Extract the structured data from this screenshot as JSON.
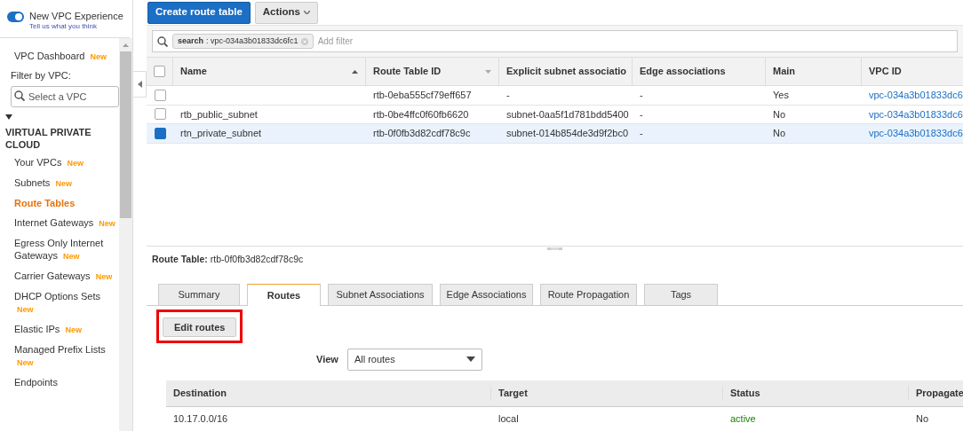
{
  "experience": {
    "label": "New VPC Experience",
    "link": "Tell us what you think",
    "on": true
  },
  "sidebar": {
    "dashboard": {
      "label": "VPC Dashboard",
      "badge": "New"
    },
    "filter_label": "Filter by VPC:",
    "filter_placeholder": "Select a VPC",
    "section": {
      "label": "VIRTUAL PRIVATE CLOUD",
      "expanded": true,
      "items": [
        {
          "label": "Your VPCs",
          "badge": "New",
          "selected": false
        },
        {
          "label": "Subnets",
          "badge": "New",
          "selected": false
        },
        {
          "label": "Route Tables",
          "selected": true
        },
        {
          "label": "Internet Gateways",
          "badge": "New",
          "selected": false
        },
        {
          "label": "Egress Only Internet Gateways",
          "badge": "New",
          "selected": false
        },
        {
          "label": "Carrier Gateways",
          "badge": "New",
          "selected": false
        },
        {
          "label": "DHCP Options Sets",
          "badge": "New",
          "selected": false
        },
        {
          "label": "Elastic IPs",
          "badge": "New",
          "selected": false
        },
        {
          "label": "Managed Prefix Lists",
          "badge": "New",
          "selected": false
        },
        {
          "label": "Endpoints",
          "selected": false
        }
      ]
    }
  },
  "toolbar": {
    "primary": "Create route table",
    "actions": "Actions"
  },
  "filter": {
    "token_key": "search",
    "token_value": ": vpc-034a3b01833dc6fc1",
    "placeholder": "Add filter"
  },
  "table": {
    "all_selected": false,
    "columns": [
      {
        "label": "Name",
        "sorted": true
      },
      {
        "label": "Route Table ID",
        "sorted": false
      },
      {
        "label": "Explicit subnet associatio"
      },
      {
        "label": "Edge associations"
      },
      {
        "label": "Main"
      },
      {
        "label": "VPC ID"
      }
    ],
    "rows": [
      {
        "selected": false,
        "cells": [
          "",
          "rtb-0eba555cf79eff657",
          "-",
          "-",
          "Yes",
          "vpc-034a3b01833dc6"
        ]
      },
      {
        "selected": false,
        "cells": [
          "rtb_public_subnet",
          "rtb-0be4ffc0f60fb6620",
          "subnet-0aa5f1d781bdd5400",
          "-",
          "No",
          "vpc-034a3b01833dc6"
        ]
      },
      {
        "selected": true,
        "cells": [
          "rtn_private_subnet",
          "rtb-0f0fb3d82cdf78c9c",
          "subnet-014b854de3d9f2bc0",
          "-",
          "No",
          "vpc-034a3b01833dc6"
        ]
      }
    ]
  },
  "detail": {
    "label": "Route Table:",
    "value": "rtb-0f0fb3d82cdf78c9c",
    "tabs": [
      {
        "label": "Summary",
        "selected": false
      },
      {
        "label": "Routes",
        "selected": true
      },
      {
        "label": "Subnet Associations",
        "selected": false
      },
      {
        "label": "Edge Associations",
        "selected": false
      },
      {
        "label": "Route Propagation",
        "selected": false
      },
      {
        "label": "Tags",
        "selected": false
      }
    ],
    "edit_button": "Edit routes",
    "highlighted": true,
    "view_label": "View",
    "view_value": "All routes",
    "routes": {
      "columns": [
        "Destination",
        "Target",
        "Status",
        "Propagate"
      ],
      "rows": [
        {
          "cells": [
            "10.17.0.0/16",
            "local",
            "active",
            "No"
          ],
          "ok": true
        }
      ]
    }
  }
}
